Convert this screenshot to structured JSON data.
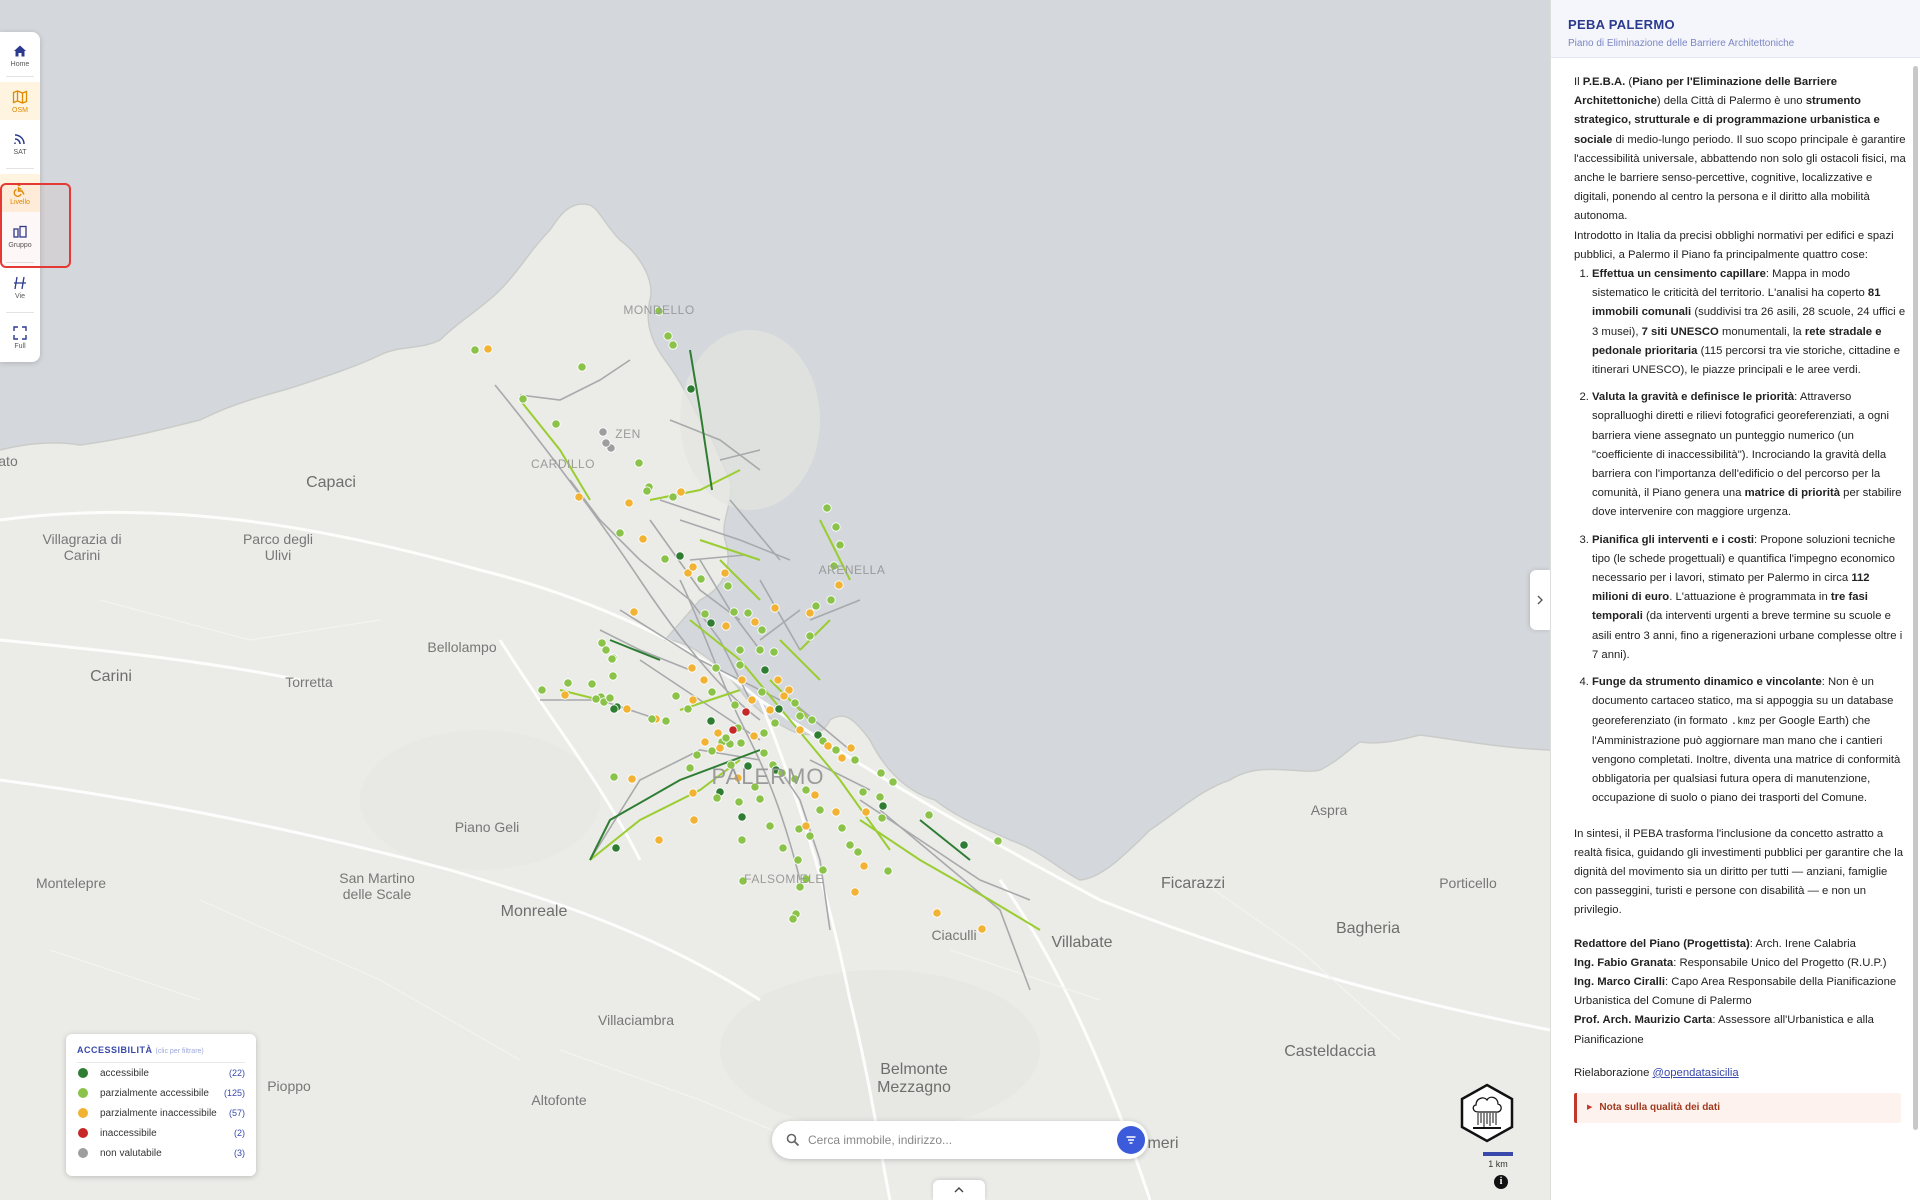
{
  "toolbar": {
    "items": [
      {
        "label": "Home",
        "icon": "home-icon"
      },
      {
        "label": "OSM",
        "icon": "map-icon"
      },
      {
        "label": "SAT",
        "icon": "satellite-icon"
      },
      {
        "label": "Livello",
        "icon": "layer-icon"
      },
      {
        "label": "Gruppo",
        "icon": "group-icon"
      },
      {
        "label": "Vie",
        "icon": "streets-icon"
      },
      {
        "label": "Full",
        "icon": "fullscreen-icon"
      }
    ],
    "active": [
      "OSM",
      "Livello"
    ]
  },
  "map": {
    "places": {
      "mondello": "MONDELLO",
      "zen": "ZEN",
      "cardillo": "CARDILLO",
      "arenella": "ARENELLA",
      "palermo": "PALERMO",
      "falsomiele": "FALSOMIELE",
      "capaci": "Capaci",
      "villagrazia": "Villagrazia di Carini",
      "parco": "Parco degli Ulivi",
      "carini": "Carini",
      "bellolampo": "Bellolampo",
      "torretta": "Torretta",
      "piano_geli": "Piano Geli",
      "montelepre": "Montelepre",
      "san_martino": "San Martino delle Scale",
      "monreale": "Monreale",
      "villaciambra": "Villaciambra",
      "pioppo": "Pioppo",
      "altofonte": "Altofonte",
      "belmonte": "Belmonte Mezzagno",
      "ciaculli": "Ciaculli",
      "villabate": "Villabate",
      "ficarazzi": "Ficarazzi",
      "aspra": "Aspra",
      "portorico": "Porticello",
      "bagheria": "Bagheria",
      "casteldaccia": "Casteldaccia",
      "ato": "ato",
      "meri": "meri"
    },
    "colors": {
      "sea": "#d4d8dc",
      "land": "#ebebe8"
    }
  },
  "legend": {
    "title": "ACCESSIBILITÀ",
    "hint": "(clic per filtrare)",
    "items": [
      {
        "label": "accessibile",
        "count": "(22)",
        "color": "#2e7d32"
      },
      {
        "label": "parzialmente accessibile",
        "count": "(125)",
        "color": "#8bc34a"
      },
      {
        "label": "parzialmente inaccessibile",
        "count": "(57)",
        "color": "#f2b233"
      },
      {
        "label": "inaccessibile",
        "count": "(2)",
        "color": "#c62828"
      },
      {
        "label": "non valutabile",
        "count": "(3)",
        "color": "#9e9e9e"
      }
    ]
  },
  "search": {
    "placeholder": "Cerca immobile, indirizzo..."
  },
  "scale": {
    "label": "1 km"
  },
  "panel": {
    "title": "PEBA PALERMO",
    "subtitle": "Piano di Eliminazione delle Barriere Architettoniche",
    "intro": {
      "a": "Il ",
      "b": "P.E.B.A.",
      "c": " (",
      "d": "Piano per l'Eliminazione delle Barriere Architettoniche",
      "e": ") della Città di Palermo è uno ",
      "f": "strumento strategico, strutturale e di programmazione urbanistica e sociale",
      "g": " di medio-lungo periodo. Il suo scopo principale è garantire l'accessibilità universale, abbattendo non solo gli ostacoli fisici, ma anche le barriere senso-percettive, cognitive, localizzative e digitali, ponendo al centro la persona e il diritto alla mobilità autonoma."
    },
    "intro2": "Introdotto in Italia da precisi obblighi normativi per edifici e spazi pubblici, a Palermo il Piano fa principalmente quattro cose:",
    "list": {
      "i1": {
        "a": "Effettua un censimento capillare",
        "b": ": Mappa in modo sistematico le criticità del territorio. L'analisi ha coperto ",
        "c": "81 immobili comunali",
        "d": " (suddivisi tra 26 asili, 28 scuole, 24 uffici e 3 musei), ",
        "e": "7 siti UNESCO",
        "f": " monumentali, la ",
        "g": "rete stradale e pedonale prioritaria",
        "h": " (115 percorsi tra vie storiche, cittadine e itinerari UNESCO), le piazze principali e le aree verdi."
      },
      "i2": {
        "a": "Valuta la gravità e definisce le priorità",
        "b": ": Attraverso sopralluoghi diretti e rilievi fotografici georeferenziati, a ogni barriera viene assegnato un punteggio numerico (un \"coefficiente di inaccessibilità\"). Incrociando la gravità della barriera con l'importanza dell'edificio o del percorso per la comunità, il Piano genera una ",
        "c": "matrice di priorità",
        "d": " per stabilire dove intervenire con maggiore urgenza."
      },
      "i3": {
        "a": "Pianifica gli interventi e i costi",
        "b": ": Propone soluzioni tecniche tipo (le schede progettuali) e quantifica l'impegno economico necessario per i lavori, stimato per Palermo in circa ",
        "c": "112 milioni di euro",
        "d": ". L'attuazione è programmata in ",
        "e": "tre fasi temporali",
        "f": " (da interventi urgenti a breve termine su scuole e asili entro 3 anni, fino a rigenerazioni urbane complesse oltre i 7 anni)."
      },
      "i4": {
        "a": "Funge da strumento dinamico e vincolante",
        "b": ": Non è un documento cartaceo statico, ma si appoggia su un database georeferenziato (in formato ",
        "c": ".kmz",
        "d": " per Google Earth) che l'Amministrazione può aggiornare man mano che i cantieri vengono completati. Inoltre, diventa una matrice di conformità obbligatoria per qualsiasi futura opera di manutenzione, occupazione di suolo o piano dei trasporti del Comune."
      }
    },
    "summary": "In sintesi, il PEBA trasforma l'inclusione da concetto astratto a realtà fisica, guidando gli investimenti pubblici per garantire che la dignità del movimento sia un diritto per tutti — anziani, famiglie con passeggini, turisti e persone con disabilità — e non un privilegio.",
    "credits": [
      {
        "role": "Redattore del Piano (Progettista)",
        "desc": ": Arch. Irene Calabria"
      },
      {
        "role": "Ing. Fabio Granata",
        "desc": ": Responsabile Unico del Progetto (R.U.P.)"
      },
      {
        "role": "Ing. Marco Ciralli",
        "desc": ": Capo Area Responsabile della Pianificazione Urbanistica del Comune di Palermo"
      },
      {
        "role": "Prof. Arch. Maurizio Carta",
        "desc": ": Assessore all'Urbanistica e alla Pianificazione"
      }
    ],
    "rielab_label": "Rielaborazione ",
    "rielab_link": "@opendatasicilia",
    "note": "Nota sulla qualità dei dati"
  }
}
